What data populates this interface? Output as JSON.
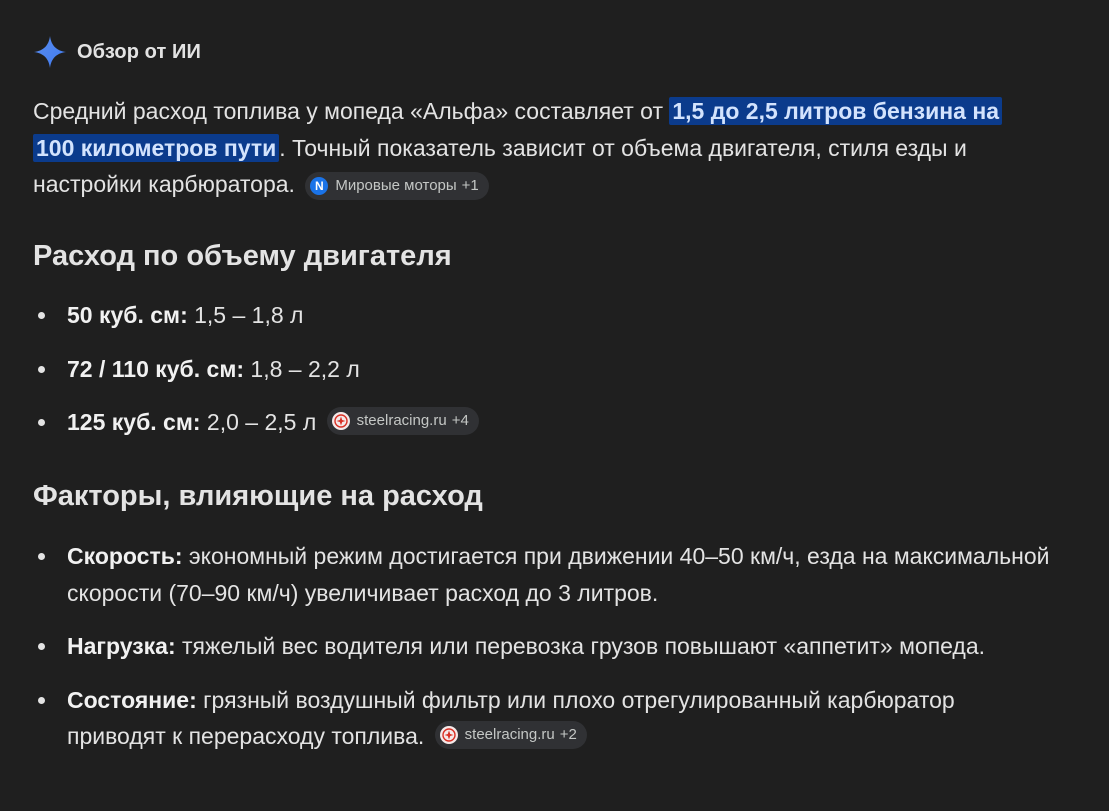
{
  "header": {
    "title": "Обзор от ИИ",
    "icon": "sparkle-icon",
    "icon_color": "#4285f4"
  },
  "intro": {
    "before": "Средний расход топлива у мопеда «Альфа» составляет от ",
    "highlight": "1,5 до 2,5 литров бензина на 100 километров пути",
    "after": ". Точный показатель зависит от объема двигателя, стиля езды и настройки карбюратора.",
    "source": {
      "name": "Мировые моторы",
      "count": "+1",
      "icon": "n-logo-icon"
    }
  },
  "section1": {
    "title": "Расход по объему двигателя",
    "items": [
      {
        "label": "50 куб. см:",
        "text": " 1,5 – 1,8 л"
      },
      {
        "label": "72 / 110 куб. см:",
        "text": " 1,8 – 2,2 л"
      },
      {
        "label": "125 куб. см:",
        "text": " 2,0 – 2,5 л",
        "source": {
          "name": "steelracing.ru",
          "count": "+4",
          "icon": "steelracing-logo-icon"
        }
      }
    ]
  },
  "section2": {
    "title": "Факторы, влияющие на расход",
    "items": [
      {
        "label": "Скорость:",
        "text": " экономный режим достигается при движении 40–50 км/ч, езда на максимальной скорости (70–90 км/ч) увеличивает расход до 3 литров."
      },
      {
        "label": "Нагрузка:",
        "text": " тяжелый вес водителя или перевозка грузов повышают «аппетит» мопеда."
      },
      {
        "label": "Состояние:",
        "text": " грязный воздушный фильтр или плохо отрегулированный карбюратор приводят к перерасходу топлива.",
        "source": {
          "name": "steelracing.ru",
          "count": "+2",
          "icon": "steelracing-logo-icon"
        }
      }
    ]
  },
  "colors": {
    "background": "#1f1f1f",
    "text": "#e3e3e3",
    "highlight_bg": "#0b3b8c",
    "highlight_text": "#d3e3fd",
    "chip_bg": "#303134"
  }
}
